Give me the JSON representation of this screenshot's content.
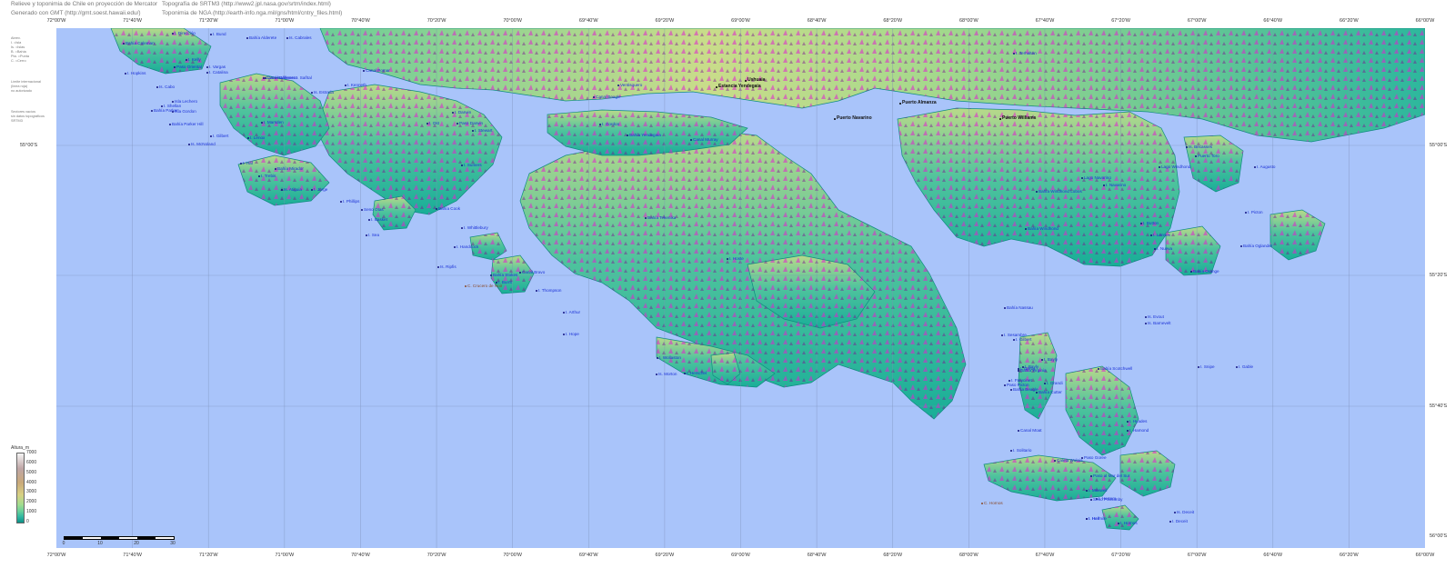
{
  "header": {
    "left_line1": "Relieve y toponimia de Chile en proyección de Mercator",
    "left_line2": "Generado con GMT (http://gmt.soest.hawaii.edu/)",
    "right_line1": "Topografía de SRTM3 (http://www2.jpl.nasa.gov/srtm/index.html)",
    "right_line2": "Toponimia de NGA (http://earth-info.nga.mil/gns/html/cntry_files.html)"
  },
  "side_notes": {
    "abbrev": [
      "Abrev.",
      "I.  =Isla",
      "Is. =Islas",
      "B.  =Bahía",
      "Pta. =Punta",
      "C.  =Cerro"
    ],
    "border": [
      "Límite internacional",
      "(línea roja)",
      "no autorizado"
    ],
    "sectors": [
      "Sectores vacíos",
      "sin datos topográficos",
      "SRTM3"
    ]
  },
  "axes": {
    "lon_top": [
      "72°00'W",
      "71°40'W",
      "71°20'W",
      "71°00'W",
      "70°40'W",
      "70°20'W",
      "70°00'W",
      "69°40'W",
      "69°20'W",
      "69°00'W",
      "68°40'W",
      "68°20'W",
      "68°00'W",
      "67°40'W",
      "67°20'W",
      "67°00'W",
      "66°40'W",
      "66°20'W",
      "66°00'W"
    ],
    "lon_bottom": [
      "72°00'W",
      "71°40'W",
      "71°20'W",
      "71°00'W",
      "70°40'W",
      "70°20'W",
      "70°00'W",
      "69°40'W",
      "69°20'W",
      "69°00'W",
      "68°40'W",
      "68°20'W",
      "68°00'W",
      "67°40'W",
      "67°20'W",
      "67°00'W",
      "66°40'W",
      "66°20'W",
      "66°00'W"
    ],
    "lat_right": [
      "55°00'S",
      "55°20'S",
      "55°40'S",
      "56°00'S"
    ],
    "lat_left": [
      "55°00'S"
    ]
  },
  "legend": {
    "title": "Altura_m",
    "labels": [
      "7000",
      "6000",
      "5000",
      "4000",
      "3000",
      "2000",
      "1000",
      "0"
    ]
  },
  "scale": {
    "labels": [
      "0",
      "10",
      "20",
      "30"
    ]
  },
  "colors": {
    "sea": "#a9c4fa",
    "land_low": "#1fb59c",
    "land_mid": "#a6d98c",
    "land_high": "#d8c98a",
    "peaks": "#e020d0",
    "grid": "#7c8fb8"
  },
  "places": [
    {
      "t": "I. Dirección",
      "c": "blue"
    },
    {
      "t": "I. Bund",
      "c": "blue"
    },
    {
      "t": "Bahía Alderete",
      "c": "blue"
    },
    {
      "t": "Is. Cabrales",
      "c": "blue"
    },
    {
      "t": "Canal Ballenero",
      "c": "blue"
    },
    {
      "t": "Bahía Coleman",
      "c": "blue"
    },
    {
      "t": "I. Kelly",
      "c": "blue"
    },
    {
      "t": "Paso Oriental",
      "c": "blue"
    },
    {
      "t": "I. Vargas",
      "c": "blue"
    },
    {
      "t": "I. Hopkins",
      "c": "blue"
    },
    {
      "t": "I. Catalina",
      "c": "blue"
    },
    {
      "t": "Canal Ballenero I. Sañtal",
      "c": "blue"
    },
    {
      "t": "Is. Cabo",
      "c": "blue"
    },
    {
      "t": "Isla Lechero",
      "c": "blue"
    },
    {
      "t": "I. Shellan",
      "c": "blue"
    },
    {
      "t": "Bahía Parker",
      "c": "blue"
    },
    {
      "t": "Isla Gordon",
      "c": "blue"
    },
    {
      "t": "Bahía Parker Hill",
      "c": "blue"
    },
    {
      "t": "I. Gilbert",
      "c": "blue"
    },
    {
      "t": "Is. McNoland",
      "c": "blue"
    },
    {
      "t": "I. Lenox",
      "c": "blue"
    },
    {
      "t": "Is. Estrada",
      "c": "blue"
    },
    {
      "t": "I. Marsden",
      "c": "blue"
    },
    {
      "t": "I. Hal",
      "c": "blue"
    },
    {
      "t": "I. Trebis",
      "c": "blue"
    },
    {
      "t": "Bahía Mirador",
      "c": "blue"
    },
    {
      "t": "Is. Atiguia",
      "c": "blue"
    },
    {
      "t": "I. Jorge",
      "c": "blue"
    },
    {
      "t": "I. Phillips",
      "c": "blue"
    },
    {
      "t": "Seno Otas",
      "c": "blue"
    },
    {
      "t": "I. Basket",
      "c": "blue"
    },
    {
      "t": "I. Sea",
      "c": "blue"
    },
    {
      "t": "Canal Pomar",
      "c": "blue"
    },
    {
      "t": "I. Kenneth",
      "c": "blue"
    },
    {
      "t": "I. Darwin",
      "c": "blue"
    },
    {
      "t": "Paso Darwin",
      "c": "blue"
    },
    {
      "t": "I. Stewart",
      "c": "blue"
    },
    {
      "t": "I. Ost",
      "c": "blue"
    },
    {
      "t": "I. Sumers",
      "c": "blue"
    },
    {
      "t": "Bahía Cook",
      "c": "blue"
    },
    {
      "t": "I. Whittlebury",
      "c": "blue"
    },
    {
      "t": "I. Handcock",
      "c": "blue"
    },
    {
      "t": "Is. Ripfis",
      "c": "blue"
    },
    {
      "t": "Bahía Stokes",
      "c": "blue"
    },
    {
      "t": "Canal Bravo",
      "c": "blue"
    },
    {
      "t": "I. Burnt",
      "c": "blue"
    },
    {
      "t": "I. Thompson",
      "c": "blue"
    },
    {
      "t": "I. Arthur",
      "c": "blue"
    },
    {
      "t": "I. Hope",
      "c": "blue"
    },
    {
      "t": "Canal Beagle",
      "c": "blue"
    },
    {
      "t": "Ventisquero",
      "c": "blue"
    },
    {
      "t": "I. Gordon",
      "c": "blue"
    },
    {
      "t": "Bahía Yendegaia",
      "c": "blue"
    },
    {
      "t": "Canal Murray",
      "c": "blue"
    },
    {
      "t": "Bahía Tekenika",
      "c": "blue"
    },
    {
      "t": "I. Hoste",
      "c": "blue"
    },
    {
      "t": "Bahía Nassau",
      "c": "blue"
    },
    {
      "t": "Bahía Orange",
      "c": "blue"
    },
    {
      "t": "I. Gilbert",
      "c": "blue"
    },
    {
      "t": "Is. Morton",
      "c": "blue"
    },
    {
      "t": "I. Herschel",
      "c": "blue"
    },
    {
      "t": "I. Wollaston",
      "c": "blue"
    },
    {
      "t": "I. Grevy",
      "c": "blue"
    },
    {
      "t": "I. Bayly",
      "c": "blue"
    },
    {
      "t": "I. Freycinet",
      "c": "blue"
    },
    {
      "t": "I. Hermite",
      "c": "blue"
    },
    {
      "t": "I. Deceit",
      "c": "blue"
    },
    {
      "t": "Is. Deceit",
      "c": "blue"
    },
    {
      "t": "Bahía Beagle",
      "c": "blue"
    },
    {
      "t": "I. Navarino",
      "c": "blue"
    },
    {
      "t": "Bahía Windhond",
      "c": "blue"
    },
    {
      "t": "Bahía Windhond Lobos",
      "c": "blue"
    },
    {
      "t": "Lago Navarino",
      "c": "blue"
    },
    {
      "t": "Lago Windhond",
      "c": "blue"
    },
    {
      "t": "Puerto Toro",
      "c": "blue"
    },
    {
      "t": "I. Picton",
      "c": "blue"
    },
    {
      "t": "I. Nueva",
      "c": "blue"
    },
    {
      "t": "I. Lennox",
      "c": "blue"
    },
    {
      "t": "Bahía Oglander",
      "c": "blue"
    },
    {
      "t": "I. Augusto",
      "c": "blue"
    },
    {
      "t": "Is. Becasses",
      "c": "blue"
    },
    {
      "t": "I. Button",
      "c": "blue"
    },
    {
      "t": "I. Snipe",
      "c": "blue"
    },
    {
      "t": "I. Gable",
      "c": "blue"
    },
    {
      "t": "Is. Evout",
      "c": "blue"
    },
    {
      "t": "Is. Barnevelt",
      "c": "blue"
    },
    {
      "t": "I. Terhalten",
      "c": "blue"
    },
    {
      "t": "I. Sesambre",
      "c": "blue"
    },
    {
      "t": "Bahía Virginia",
      "c": "blue"
    },
    {
      "t": "Paso Picton",
      "c": "blue"
    },
    {
      "t": "Bahía Cutter",
      "c": "blue"
    },
    {
      "t": "Canal Moat",
      "c": "blue"
    },
    {
      "t": "I. Solitario",
      "c": "blue"
    },
    {
      "t": "Caleta Wulaia",
      "c": "blue"
    },
    {
      "t": "Seno Ponsonby",
      "c": "blue"
    },
    {
      "t": "I. Maxwell",
      "c": "blue"
    },
    {
      "t": "Paso al Mar del Sur",
      "c": "blue"
    },
    {
      "t": "I. Hall",
      "c": "blue"
    },
    {
      "t": "I. Herrera",
      "c": "blue"
    },
    {
      "t": "I. Hornos",
      "c": "blue"
    },
    {
      "t": "Paso Goree",
      "c": "blue"
    },
    {
      "t": "I. Bayly",
      "c": "blue"
    },
    {
      "t": "I. Grandi",
      "c": "blue"
    },
    {
      "t": "Bahía Scotchwell",
      "c": "blue"
    },
    {
      "t": "I. Hamond",
      "c": "blue"
    },
    {
      "t": "I. Hyades",
      "c": "blue"
    },
    {
      "t": "Ushuaia",
      "c": "dark"
    },
    {
      "t": "Estancia Yendegaia",
      "c": "dark"
    },
    {
      "t": "Puerto Navarino",
      "c": "dark"
    },
    {
      "t": "Puerto Williams",
      "c": "dark"
    },
    {
      "t": "Puerto Almanza",
      "c": "dark"
    },
    {
      "t": "C. Hornos",
      "c": "brown"
    },
    {
      "t": "C. Crucero de Noir",
      "c": "brown"
    }
  ]
}
